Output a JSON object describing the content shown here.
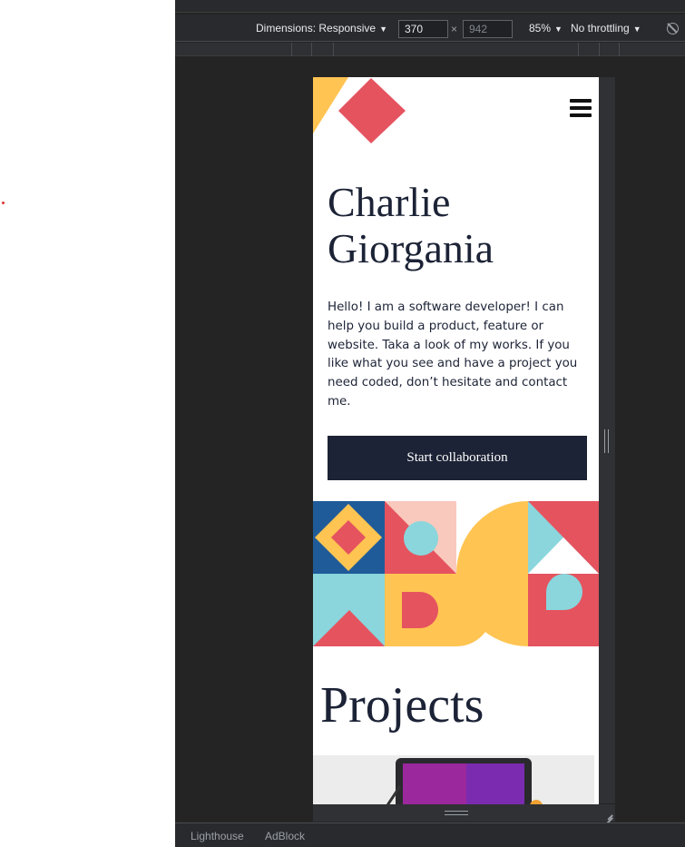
{
  "devtools": {
    "dimensions_label": "Dimensions: Responsive",
    "width_value": "370",
    "height_placeholder": "942",
    "times_symbol": "×",
    "zoom": "85%",
    "throttling": "No throttling",
    "bottom_tabs": [
      "Lighthouse",
      "AdBlock"
    ],
    "icons": {
      "caret": "caret-down-icon",
      "rotate": "rotate-icon",
      "resize": "resize-corner-icon"
    }
  },
  "page": {
    "hero": {
      "title_line1": "Charlie",
      "title_line2": "Giorgania",
      "intro": "Hello! I am a software developer! I can help you build a product, feature or website. Taka a look of my works. If you like what you see and have a project you need coded, don’t hesitate and contact me.",
      "cta_label": "Start collaboration"
    },
    "projects_title": "Projects",
    "icons": {
      "menu": "hamburger-menu-icon",
      "logo": "geometric-logo"
    }
  },
  "colors": {
    "navy": "#1c2336",
    "red": "#e5535f",
    "yellow": "#ffc452",
    "teal": "#8ad6dc",
    "blue": "#1f5b99",
    "pink": "#f9c9bd"
  }
}
